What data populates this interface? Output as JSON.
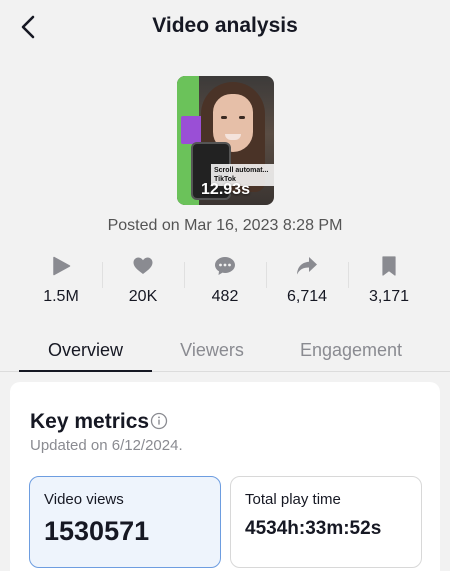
{
  "header": {
    "title": "Video analysis",
    "back_icon": "chevron-left-icon"
  },
  "video": {
    "caption_overlay": "Scroll automat... TikTok",
    "duration": "12.93s",
    "posted": "Posted on Mar 16, 2023 8:28 PM"
  },
  "stats": [
    {
      "icon": "play-icon",
      "value": "1.5M"
    },
    {
      "icon": "heart-icon",
      "value": "20K"
    },
    {
      "icon": "comment-icon",
      "value": "482"
    },
    {
      "icon": "share-icon",
      "value": "6,714"
    },
    {
      "icon": "bookmark-icon",
      "value": "3,171"
    }
  ],
  "tabs": [
    {
      "label": "Overview",
      "active": true
    },
    {
      "label": "Viewers",
      "active": false
    },
    {
      "label": "Engagement",
      "active": false
    }
  ],
  "key_metrics": {
    "title": "Key metrics",
    "updated": "Updated on 6/12/2024.",
    "metrics": [
      {
        "label": "Video views",
        "value": "1530571",
        "selected": true
      },
      {
        "label": "Total play time",
        "value": "4534h:33m:52s",
        "selected": false
      }
    ]
  },
  "colors": {
    "icon_gray": "#8a8b91",
    "selected_border": "#6d9de0",
    "selected_bg": "#eef4fc"
  }
}
